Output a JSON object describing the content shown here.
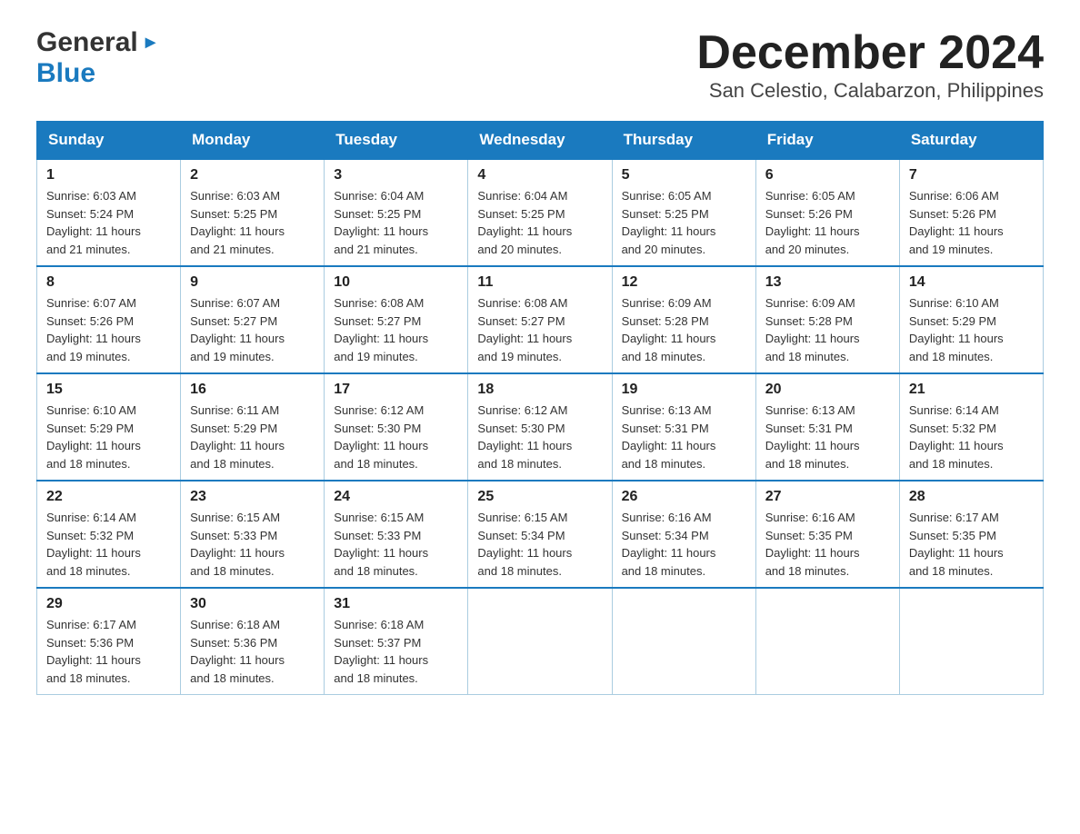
{
  "header": {
    "logo": {
      "general": "General",
      "blue": "Blue",
      "arrow": "▶"
    },
    "title": "December 2024",
    "subtitle": "San Celestio, Calabarzon, Philippines"
  },
  "calendar": {
    "days": [
      "Sunday",
      "Monday",
      "Tuesday",
      "Wednesday",
      "Thursday",
      "Friday",
      "Saturday"
    ],
    "weeks": [
      [
        {
          "num": "1",
          "sunrise": "6:03 AM",
          "sunset": "5:24 PM",
          "daylight": "11 hours and 21 minutes."
        },
        {
          "num": "2",
          "sunrise": "6:03 AM",
          "sunset": "5:25 PM",
          "daylight": "11 hours and 21 minutes."
        },
        {
          "num": "3",
          "sunrise": "6:04 AM",
          "sunset": "5:25 PM",
          "daylight": "11 hours and 21 minutes."
        },
        {
          "num": "4",
          "sunrise": "6:04 AM",
          "sunset": "5:25 PM",
          "daylight": "11 hours and 20 minutes."
        },
        {
          "num": "5",
          "sunrise": "6:05 AM",
          "sunset": "5:25 PM",
          "daylight": "11 hours and 20 minutes."
        },
        {
          "num": "6",
          "sunrise": "6:05 AM",
          "sunset": "5:26 PM",
          "daylight": "11 hours and 20 minutes."
        },
        {
          "num": "7",
          "sunrise": "6:06 AM",
          "sunset": "5:26 PM",
          "daylight": "11 hours and 19 minutes."
        }
      ],
      [
        {
          "num": "8",
          "sunrise": "6:07 AM",
          "sunset": "5:26 PM",
          "daylight": "11 hours and 19 minutes."
        },
        {
          "num": "9",
          "sunrise": "6:07 AM",
          "sunset": "5:27 PM",
          "daylight": "11 hours and 19 minutes."
        },
        {
          "num": "10",
          "sunrise": "6:08 AM",
          "sunset": "5:27 PM",
          "daylight": "11 hours and 19 minutes."
        },
        {
          "num": "11",
          "sunrise": "6:08 AM",
          "sunset": "5:27 PM",
          "daylight": "11 hours and 19 minutes."
        },
        {
          "num": "12",
          "sunrise": "6:09 AM",
          "sunset": "5:28 PM",
          "daylight": "11 hours and 18 minutes."
        },
        {
          "num": "13",
          "sunrise": "6:09 AM",
          "sunset": "5:28 PM",
          "daylight": "11 hours and 18 minutes."
        },
        {
          "num": "14",
          "sunrise": "6:10 AM",
          "sunset": "5:29 PM",
          "daylight": "11 hours and 18 minutes."
        }
      ],
      [
        {
          "num": "15",
          "sunrise": "6:10 AM",
          "sunset": "5:29 PM",
          "daylight": "11 hours and 18 minutes."
        },
        {
          "num": "16",
          "sunrise": "6:11 AM",
          "sunset": "5:29 PM",
          "daylight": "11 hours and 18 minutes."
        },
        {
          "num": "17",
          "sunrise": "6:12 AM",
          "sunset": "5:30 PM",
          "daylight": "11 hours and 18 minutes."
        },
        {
          "num": "18",
          "sunrise": "6:12 AM",
          "sunset": "5:30 PM",
          "daylight": "11 hours and 18 minutes."
        },
        {
          "num": "19",
          "sunrise": "6:13 AM",
          "sunset": "5:31 PM",
          "daylight": "11 hours and 18 minutes."
        },
        {
          "num": "20",
          "sunrise": "6:13 AM",
          "sunset": "5:31 PM",
          "daylight": "11 hours and 18 minutes."
        },
        {
          "num": "21",
          "sunrise": "6:14 AM",
          "sunset": "5:32 PM",
          "daylight": "11 hours and 18 minutes."
        }
      ],
      [
        {
          "num": "22",
          "sunrise": "6:14 AM",
          "sunset": "5:32 PM",
          "daylight": "11 hours and 18 minutes."
        },
        {
          "num": "23",
          "sunrise": "6:15 AM",
          "sunset": "5:33 PM",
          "daylight": "11 hours and 18 minutes."
        },
        {
          "num": "24",
          "sunrise": "6:15 AM",
          "sunset": "5:33 PM",
          "daylight": "11 hours and 18 minutes."
        },
        {
          "num": "25",
          "sunrise": "6:15 AM",
          "sunset": "5:34 PM",
          "daylight": "11 hours and 18 minutes."
        },
        {
          "num": "26",
          "sunrise": "6:16 AM",
          "sunset": "5:34 PM",
          "daylight": "11 hours and 18 minutes."
        },
        {
          "num": "27",
          "sunrise": "6:16 AM",
          "sunset": "5:35 PM",
          "daylight": "11 hours and 18 minutes."
        },
        {
          "num": "28",
          "sunrise": "6:17 AM",
          "sunset": "5:35 PM",
          "daylight": "11 hours and 18 minutes."
        }
      ],
      [
        {
          "num": "29",
          "sunrise": "6:17 AM",
          "sunset": "5:36 PM",
          "daylight": "11 hours and 18 minutes."
        },
        {
          "num": "30",
          "sunrise": "6:18 AM",
          "sunset": "5:36 PM",
          "daylight": "11 hours and 18 minutes."
        },
        {
          "num": "31",
          "sunrise": "6:18 AM",
          "sunset": "5:37 PM",
          "daylight": "11 hours and 18 minutes."
        },
        null,
        null,
        null,
        null
      ]
    ],
    "labels": {
      "sunrise": "Sunrise:",
      "sunset": "Sunset:",
      "daylight": "Daylight:"
    }
  }
}
